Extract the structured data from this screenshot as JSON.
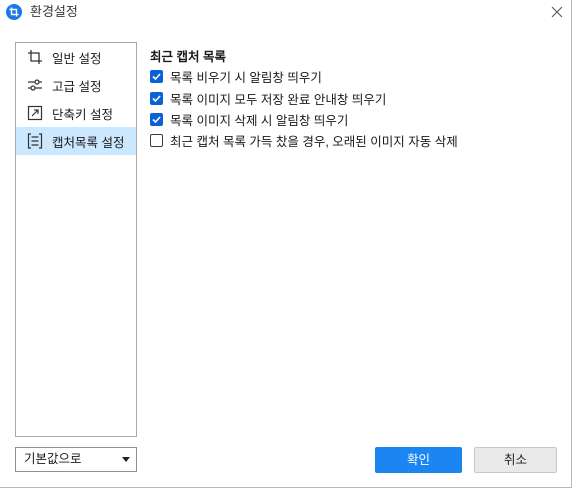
{
  "window": {
    "title": "환경설정",
    "app_icon": "crop-app-icon",
    "close_icon": "close-icon"
  },
  "sidebar": {
    "items": [
      {
        "label": "일반 설정",
        "icon": "crop-icon",
        "selected": false
      },
      {
        "label": "고급 설정",
        "icon": "sliders-icon",
        "selected": false
      },
      {
        "label": "단축키 설정",
        "icon": "shortcut-icon",
        "selected": false
      },
      {
        "label": "캡처목록 설정",
        "icon": "list-icon",
        "selected": true
      }
    ]
  },
  "main": {
    "section_title": "최근 캡처 목록",
    "options": [
      {
        "label": "목록 비우기 시 알림창 띄우기",
        "checked": true
      },
      {
        "label": "목록 이미지 모두 저장 완료 안내창 띄우기",
        "checked": true
      },
      {
        "label": "목록 이미지 삭제 시 알림창 띄우기",
        "checked": true
      },
      {
        "label": "최근 캡처 목록 가득 찼을 경우, 오래된 이미지 자동 삭제",
        "checked": false
      }
    ]
  },
  "footer": {
    "reset_dropdown": {
      "selected": "기본값으로",
      "arrow_icon": "caret-down-icon"
    },
    "ok_label": "확인",
    "cancel_label": "취소"
  },
  "colors": {
    "accent": "#1b85f2",
    "checkbox": "#0b62d6",
    "selected_item_bg": "#cce8ff"
  }
}
